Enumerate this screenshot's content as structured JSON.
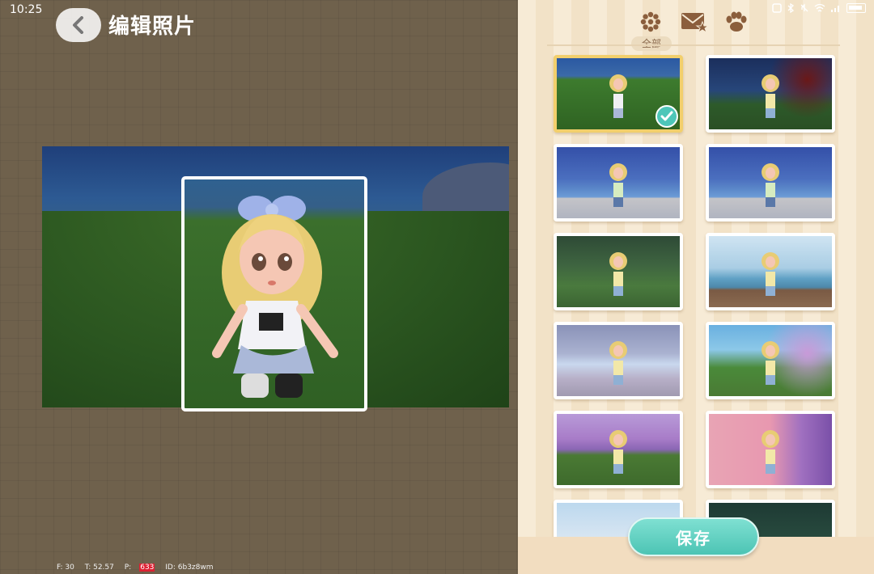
{
  "status_bar": {
    "time": "10:25",
    "icons": [
      "nfc-icon",
      "bluetooth-icon",
      "mute-icon",
      "wifi-icon",
      "signal-icon",
      "battery-icon"
    ]
  },
  "header": {
    "title": "编辑照片",
    "back_icon": "chevron-left-icon"
  },
  "debug": {
    "fps": "F: 30",
    "time": "T: 52.57",
    "p_label": "P:",
    "p_value": "633",
    "id": "ID: 6b3z8wm"
  },
  "album": {
    "tabs": [
      {
        "icon": "flower-icon",
        "label": "全部",
        "selected": true
      },
      {
        "icon": "mail-star-icon"
      },
      {
        "icon": "paw-icon"
      }
    ],
    "thumbnails": [
      {
        "scene": "grass-night-sitting",
        "selected": true
      },
      {
        "scene": "garden-night-standing",
        "selected": false
      },
      {
        "scene": "pier-night-standing",
        "selected": false
      },
      {
        "scene": "pier-night-standing-2",
        "selected": false
      },
      {
        "scene": "forest-panda",
        "selected": false
      },
      {
        "scene": "dock-day",
        "selected": false
      },
      {
        "scene": "fountain-plaza",
        "selected": false
      },
      {
        "scene": "lavender-field-1",
        "selected": false
      },
      {
        "scene": "lavender-field-2",
        "selected": false
      },
      {
        "scene": "lavender-field-3",
        "selected": false
      },
      {
        "scene": "castle-day",
        "selected": false
      },
      {
        "scene": "tree-night",
        "selected": false
      }
    ],
    "save_label": "保存"
  },
  "colors": {
    "accent": "#4cc4b4",
    "selected_border": "#f2cf6c",
    "panel": "#f7ebd6",
    "editor_bg": "#6f614c"
  }
}
